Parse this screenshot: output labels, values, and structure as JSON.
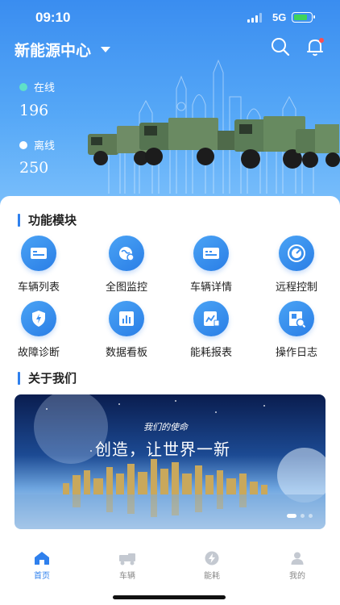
{
  "status_bar": {
    "time": "09:10",
    "network": "5G"
  },
  "header": {
    "center_name": "新能源中心"
  },
  "stats": {
    "online": {
      "label": "在线",
      "value": "196",
      "color": "#5fe0c8"
    },
    "offline": {
      "label": "离线",
      "value": "250",
      "color": "#ffffff"
    }
  },
  "modules": {
    "title": "功能模块",
    "items": [
      {
        "label": "车辆列表",
        "icon": "vehicle-list-icon"
      },
      {
        "label": "全图监控",
        "icon": "globe-monitor-icon"
      },
      {
        "label": "车辆详情",
        "icon": "vehicle-detail-icon"
      },
      {
        "label": "远程控制",
        "icon": "remote-control-icon"
      },
      {
        "label": "故障诊断",
        "icon": "shield-bolt-icon"
      },
      {
        "label": "数据看板",
        "icon": "bar-chart-icon"
      },
      {
        "label": "能耗报表",
        "icon": "energy-report-icon"
      },
      {
        "label": "操作日志",
        "icon": "operation-log-icon"
      }
    ]
  },
  "about": {
    "title": "关于我们",
    "banner_small": "我们的使命",
    "banner_big": "创造，让世界一新"
  },
  "tabbar": [
    {
      "label": "首页",
      "icon": "home-icon",
      "active": true
    },
    {
      "label": "车辆",
      "icon": "truck-icon",
      "active": false
    },
    {
      "label": "能耗",
      "icon": "bolt-icon",
      "active": false
    },
    {
      "label": "我的",
      "icon": "user-icon",
      "active": false
    }
  ],
  "colors": {
    "accent": "#2f80ed",
    "hero_top": "#3a8df0",
    "notification_dot": "#ff4d4f"
  }
}
